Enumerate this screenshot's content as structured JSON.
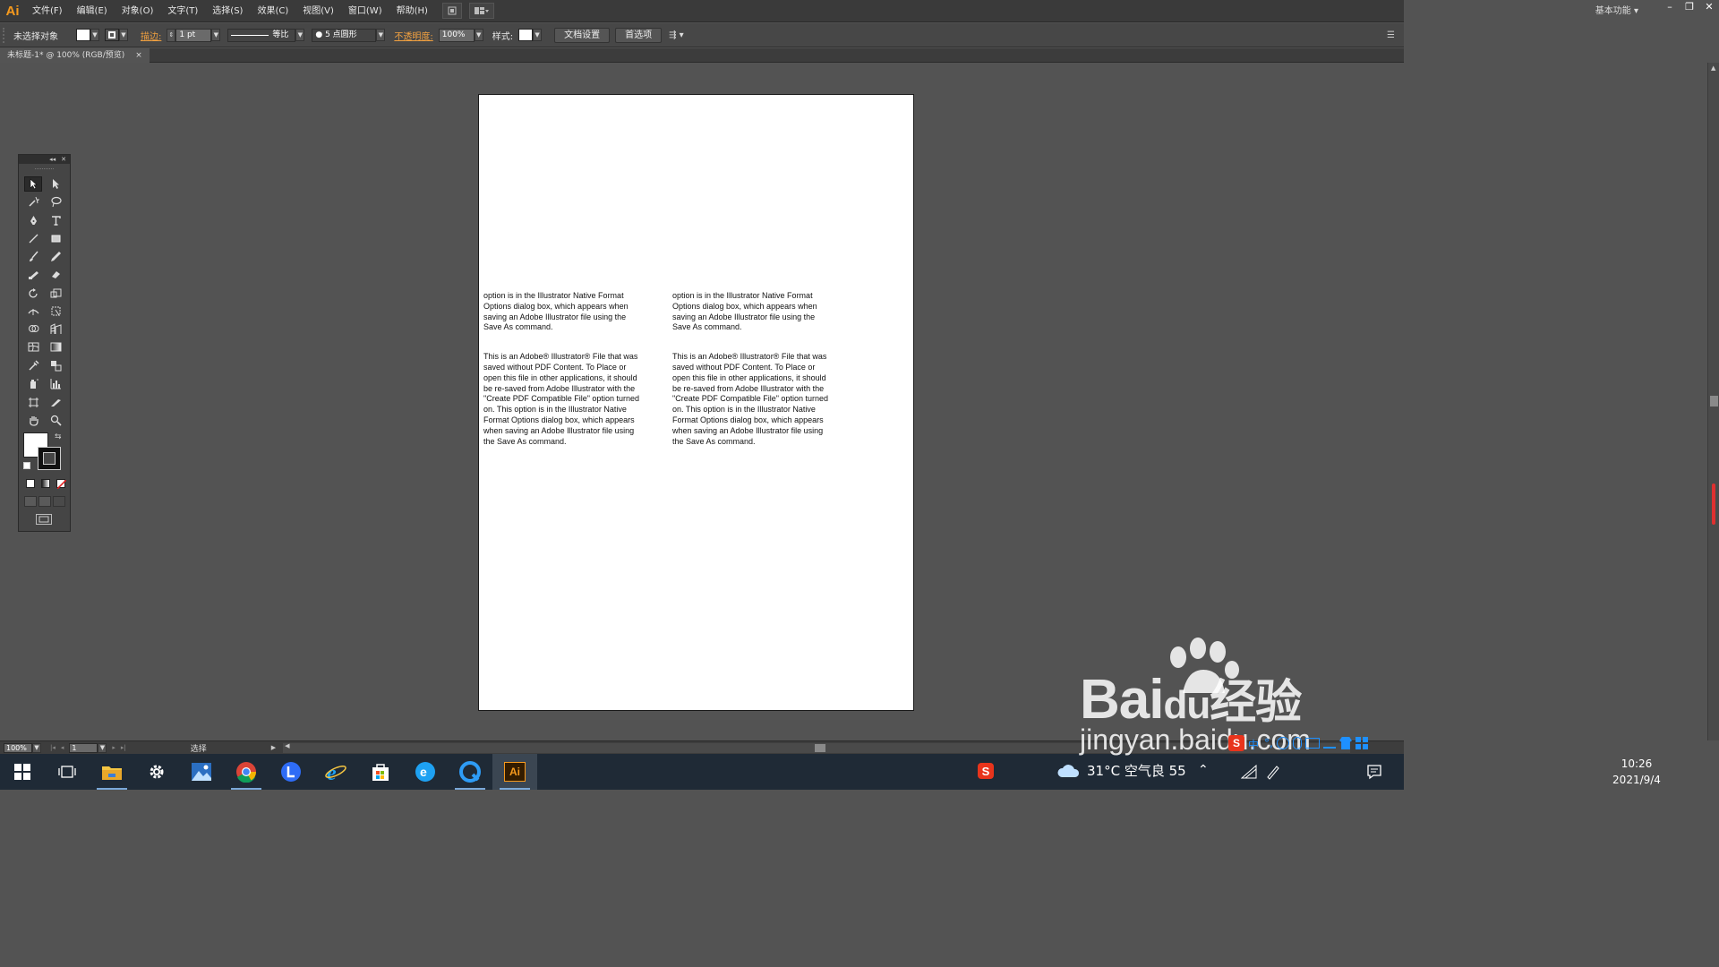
{
  "app": {
    "logo": "Ai",
    "workspace": "基本功能"
  },
  "menu": [
    "文件(F)",
    "编辑(E)",
    "对象(O)",
    "文字(T)",
    "选择(S)",
    "效果(C)",
    "视图(V)",
    "窗口(W)",
    "帮助(H)"
  ],
  "control": {
    "selection": "未选择对象",
    "stroke_label": "描边:",
    "stroke_weight": "1 pt",
    "stroke_profile": "等比",
    "brush": "5 点圆形",
    "opacity_label": "不透明度:",
    "opacity_value": "100%",
    "style_label": "样式:",
    "doc_setup": "文档设置",
    "preferences": "首选项"
  },
  "document": {
    "tab_title": "未标题-1* @ 100% (RGB/预览)",
    "close": "×"
  },
  "artboard": {
    "col1_p1": "option is in the Illustrator Native Format Options dialog box, which appears when saving an Adobe Illustrator file using the Save As command.",
    "col1_p2": "This is an Adobe® Illustrator® File that was saved without PDF Content. To Place or open this file in other applications, it should be re-saved from Adobe Illustrator with the \"Create PDF Compatible File\" option turned on. This option is in the Illustrator Native Format Options dialog box, which appears when saving an Adobe Illustrator file using the Save As command.",
    "col2_p1": "option is in the Illustrator Native Format Options dialog box, which appears when saving an Adobe Illustrator file using the Save As command.",
    "col2_p2": "This is an Adobe® Illustrator® File that was saved without PDF Content. To Place or open this file in other applications, it should be re-saved from Adobe Illustrator with the \"Create PDF Compatible File\" option turned on. This option is in the Illustrator Native Format Options dialog box, which appears when saving an Adobe Illustrator file using the Save As command."
  },
  "status": {
    "zoom": "100%",
    "page": "1",
    "tool": "选择"
  },
  "taskbar": {
    "weather": "31°C 空气良 55",
    "time": "10:26",
    "date": "2021/9/4",
    "ai_label": "Ai"
  },
  "watermark": {
    "brand": "Bai",
    "brand2": "du",
    "brand3": "经验",
    "url": "jingyan.baidu.com"
  },
  "colors": {
    "accent": "#f79a1d",
    "ui_bg": "#535353",
    "artboard": "#ffffff"
  }
}
